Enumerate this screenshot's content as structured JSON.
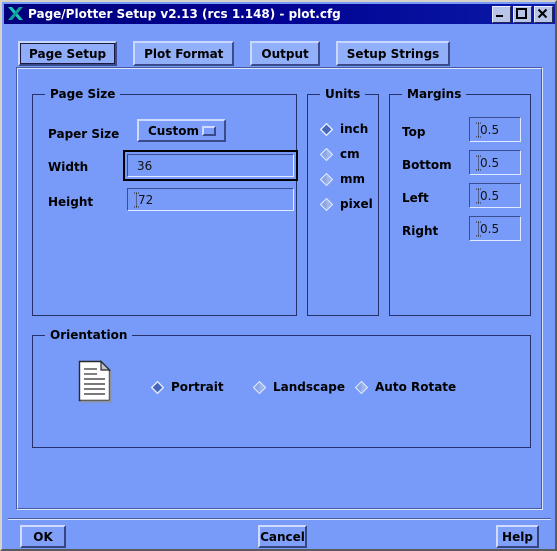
{
  "window": {
    "title": "Page/Plotter Setup v2.13 (rcs 1.148) - plot.cfg",
    "icon": "x-logo-icon",
    "controls": {
      "minimize": "minimize-icon",
      "maximize": "maximize-icon",
      "close": "close-icon"
    }
  },
  "tabs": [
    {
      "label": "Page Setup",
      "active": true
    },
    {
      "label": "Plot Format",
      "active": false
    },
    {
      "label": "Output",
      "active": false
    },
    {
      "label": "Setup Strings",
      "active": false
    }
  ],
  "page_size": {
    "title": "Page Size",
    "paper_size": {
      "label": "Paper Size",
      "value": "Custom",
      "options": [
        "Custom"
      ]
    },
    "width": {
      "label": "Width",
      "value": "36",
      "focused": true
    },
    "height": {
      "label": "Height",
      "value": "72",
      "focused": false
    }
  },
  "units": {
    "title": "Units",
    "options": [
      {
        "label": "inch",
        "selected": true
      },
      {
        "label": "cm",
        "selected": false
      },
      {
        "label": "mm",
        "selected": false
      },
      {
        "label": "pixel",
        "selected": false
      }
    ]
  },
  "margins": {
    "title": "Margins",
    "fields": [
      {
        "label": "Top",
        "value": "0.5"
      },
      {
        "label": "Bottom",
        "value": "0.5"
      },
      {
        "label": "Left",
        "value": "0.5"
      },
      {
        "label": "Right",
        "value": "0.5"
      }
    ]
  },
  "orientation": {
    "title": "Orientation",
    "preview_icon": "document-page-icon",
    "options": [
      {
        "label": "Portrait",
        "selected": true
      },
      {
        "label": "Landscape",
        "selected": false
      },
      {
        "label": "Auto Rotate",
        "selected": false
      }
    ]
  },
  "actions": {
    "ok": "OK",
    "cancel": "Cancel",
    "help": "Help"
  },
  "colors": {
    "background": "#789af8",
    "titlebar": "#00008f",
    "title_text": "#ffffff",
    "border_dark": "#27316b",
    "focus_border": "#000000"
  }
}
